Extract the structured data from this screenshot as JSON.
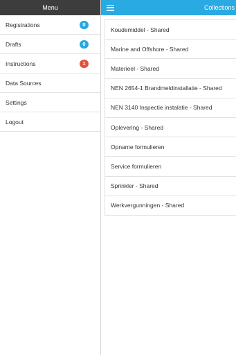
{
  "menu": {
    "title": "Menu",
    "items": [
      {
        "label": "Registrations",
        "badge": "0",
        "badge_color": "#29a8e0"
      },
      {
        "label": "Drafts",
        "badge": "0",
        "badge_color": "#29a8e0"
      },
      {
        "label": "Instructions",
        "badge": "1",
        "badge_color": "#e2513c"
      },
      {
        "label": "Data Sources"
      },
      {
        "label": "Settings"
      },
      {
        "label": "Logout"
      }
    ]
  },
  "header": {
    "title": "Collections",
    "menu_icon": "hamburger-icon",
    "accent_color": "#2aaae2"
  },
  "collections": [
    "Koudemiddel - Shared",
    "Marine and Offshore - Shared",
    "Materieel - Shared",
    "NEN 2654-1 Brandmeldinstallatie - Shared",
    "NEN 3140 Inspectie instalatie - Shared",
    "Oplevering - Shared",
    "Opname formulieren",
    "Service formulieren",
    "Sprinkler - Shared",
    "Werkvergunningen - Shared"
  ]
}
